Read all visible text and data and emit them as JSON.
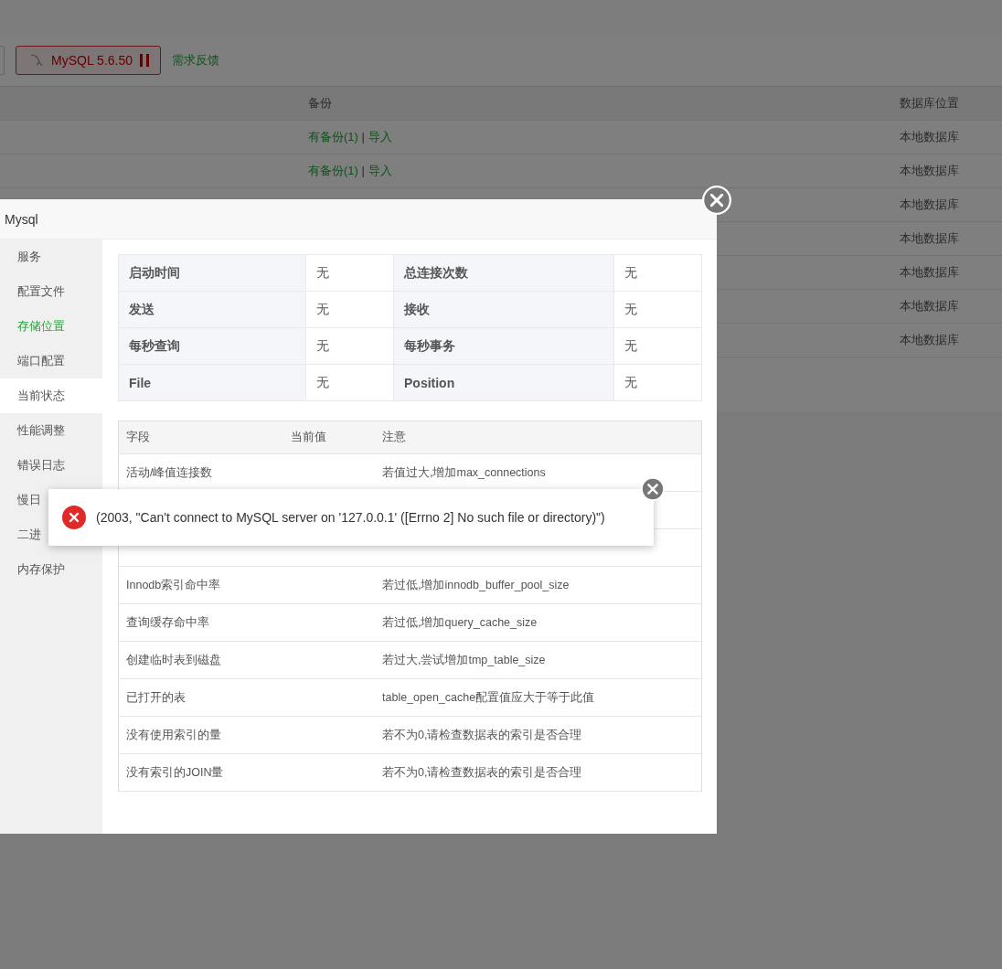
{
  "toolbar": {
    "version_button": "MySQL 5.6.50",
    "feedback_link": "需求反馈"
  },
  "db_table": {
    "columns": [
      "备份",
      "数据库位置"
    ],
    "rows": [
      {
        "backup": "有备份(1)",
        "separator": "|",
        "import": "导入",
        "location": "本地数据库"
      },
      {
        "backup": "有备份(1)",
        "separator": "|",
        "import": "导入",
        "location": "本地数据库"
      },
      {
        "location": "本地数据库"
      },
      {
        "location": "本地数据库"
      },
      {
        "location": "本地数据库"
      },
      {
        "location": "本地数据库"
      },
      {
        "location": "本地数据库"
      }
    ]
  },
  "dialog": {
    "title": "Mysql",
    "menu": [
      {
        "label": "服务",
        "selected": false,
        "highlighted": false
      },
      {
        "label": "配置文件",
        "selected": false,
        "highlighted": false
      },
      {
        "label": "存储位置",
        "selected": false,
        "highlighted": true
      },
      {
        "label": "端口配置",
        "selected": false,
        "highlighted": false
      },
      {
        "label": "当前状态",
        "selected": true,
        "highlighted": false
      },
      {
        "label": "性能调整",
        "selected": false,
        "highlighted": false
      },
      {
        "label": "错误日志",
        "selected": false,
        "highlighted": false
      },
      {
        "label": "慢日",
        "selected": false,
        "highlighted": false
      },
      {
        "label": "二进",
        "selected": false,
        "highlighted": false
      },
      {
        "label": "内存保护",
        "selected": false,
        "highlighted": false
      }
    ],
    "status": [
      {
        "label": "启动时间",
        "value": "无"
      },
      {
        "label": "总连接次数",
        "value": "无"
      },
      {
        "label": "发送",
        "value": "无"
      },
      {
        "label": "接收",
        "value": "无"
      },
      {
        "label": "每秒查询",
        "value": "无"
      },
      {
        "label": "每秒事务",
        "value": "无"
      },
      {
        "label": "File",
        "value": "无"
      },
      {
        "label": "Position",
        "value": "无"
      }
    ],
    "fields_table": {
      "columns": [
        "字段",
        "当前值",
        "注意"
      ],
      "rows": [
        {
          "field": "活动/峰值连接数",
          "note": "若值过大,增加max_connections"
        },
        {},
        {},
        {
          "field": "Innodb索引命中率",
          "note": "若过低,增加innodb_buffer_pool_size"
        },
        {
          "field": "查询缓存命中率",
          "note": "若过低,增加query_cache_size"
        },
        {
          "field": "创建临时表到磁盘",
          "note": "若过大,尝试增加tmp_table_size"
        },
        {
          "field": "已打开的表",
          "note": "table_open_cache配置值应大于等于此值"
        },
        {
          "field": "没有使用索引的量",
          "note": "若不为0,请检查数据表的索引是否合理"
        },
        {
          "field": "没有索引的JOIN量",
          "note": "若不为0,请检查数据表的索引是否合理"
        }
      ]
    }
  },
  "toast": {
    "message": "(2003, \"Can't connect to MySQL server on '127.0.0.1' ([Errno 2] No such file or directory)\")"
  }
}
